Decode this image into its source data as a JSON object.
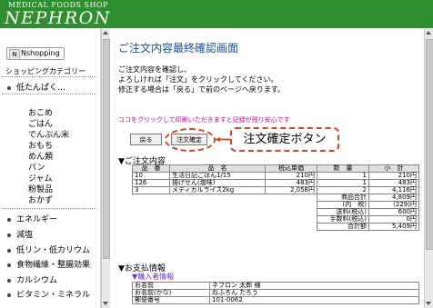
{
  "header": {
    "subtitle": "MEDICAL FOODS SHOP",
    "brand": "NEPHRON"
  },
  "sidebar": {
    "badge": "Nshopping",
    "category_title": "ショッピングカテゴリー",
    "group_open": "低たんぱく…",
    "sub_items": [
      "おこめ",
      "ごはん",
      "でんぷん米",
      "おもち",
      "めん類",
      "パン",
      "ジャム",
      "粉製品",
      "おかず"
    ],
    "items": [
      "エネルギー",
      "減塩",
      "低リン・低カリウム",
      "食物繊維・整腸効果",
      "カルシウム",
      "ビタミン・ミネラル"
    ]
  },
  "main": {
    "title": "ご注文内容最終確認画面",
    "intro": [
      "ご注文内容を確認し、",
      "よろしければ「注文」をクリックしてください。",
      "修正する場合は「戻る」で前のページへ戻ります。"
    ],
    "print_note": "ココをクリックして印刷いただきますと記録が残り安心です",
    "back_button": "戻る",
    "confirm_button": "注文確定",
    "callout": "注文確定ボタン",
    "order_section": "▼ご注文内容",
    "order_table": {
      "headers": [
        "品　番",
        "品　名",
        "税込単価",
        "数　量",
        "小　計"
      ],
      "rows": [
        [
          "10",
          "生活日記ごはん1/15",
          "210",
          "1",
          "210"
        ],
        [
          "126",
          "揚げせん(塩味)",
          "483",
          "1",
          "483"
        ],
        [
          "3",
          "メディカルライス2kg",
          "2,058",
          "2",
          "4,116"
        ]
      ],
      "summary": [
        {
          "label": "商品合計",
          "value": "4,809"
        },
        {
          "label": "(内　税)",
          "value": "(229)"
        },
        {
          "label": "送料(税込)",
          "value": "600"
        },
        {
          "label": "手数料(税込)",
          "value": "0"
        },
        {
          "label": "合計額",
          "value": "5,409"
        }
      ],
      "currency": "円"
    },
    "payment_section": "▼お支払情報",
    "buyer_heading": "▼購入者情報",
    "buyer": [
      {
        "label": "お名前",
        "value": "ネフロン 太郎 様"
      },
      {
        "label": "お名前(かな)",
        "value": "ねふろん たろう"
      },
      {
        "label": "郵便番号",
        "value": "101-0062"
      }
    ]
  },
  "colors": {
    "header": "#2f8f2f",
    "title": "#1a4fa0",
    "note": "#cc0099",
    "callout": "#e04020",
    "subhead": "#6633cc"
  }
}
